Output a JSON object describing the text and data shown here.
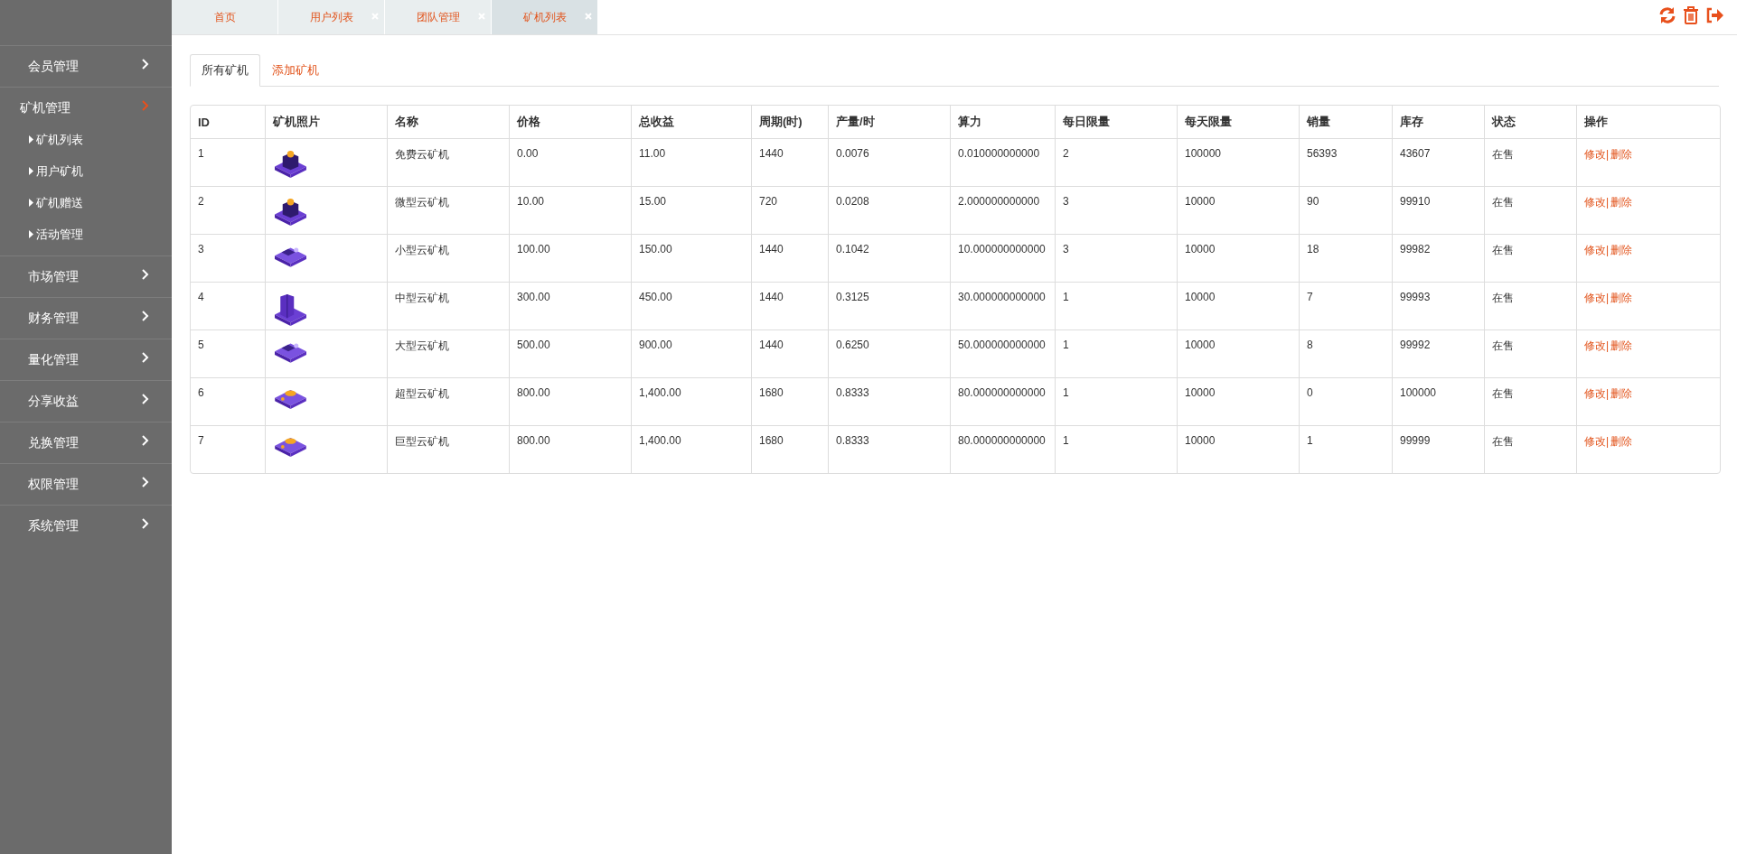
{
  "sidebar": {
    "items": [
      {
        "label": "会员管理",
        "expanded": false
      },
      {
        "label": "矿机管理",
        "expanded": true,
        "children": [
          {
            "label": "矿机列表"
          },
          {
            "label": "用户矿机"
          },
          {
            "label": "矿机赠送"
          },
          {
            "label": "活动管理"
          }
        ]
      },
      {
        "label": "市场管理",
        "expanded": false
      },
      {
        "label": "财务管理",
        "expanded": false
      },
      {
        "label": "量化管理",
        "expanded": false
      },
      {
        "label": "分享收益",
        "expanded": false
      },
      {
        "label": "兑换管理",
        "expanded": false
      },
      {
        "label": "权限管理",
        "expanded": false
      },
      {
        "label": "系统管理",
        "expanded": false
      }
    ]
  },
  "tabs": [
    {
      "label": "首页",
      "selected": false,
      "closable": false
    },
    {
      "label": "用户列表",
      "selected": false,
      "closable": true
    },
    {
      "label": "团队管理",
      "selected": false,
      "closable": true
    },
    {
      "label": "矿机列表",
      "selected": true,
      "closable": true
    }
  ],
  "toolbar": [
    {
      "kind": "refresh"
    },
    {
      "kind": "trash"
    },
    {
      "kind": "logout"
    }
  ],
  "sub_tabs": [
    {
      "label": "所有矿机",
      "selected": true
    },
    {
      "label": "添加矿机",
      "selected": false
    }
  ],
  "table": {
    "columns": [
      "ID",
      "矿机照片",
      "名称",
      "价格",
      "总收益",
      "周期(时)",
      "产量/时",
      "算力",
      "每日限量",
      "每天限量",
      "销量",
      "库存",
      "状态",
      "操作"
    ],
    "separator": "|",
    "rows": [
      {
        "id": "1",
        "kind": "tower",
        "name": "免费云矿机",
        "price": "0.00",
        "total": "11.00",
        "period": "1440",
        "output": "0.0076",
        "power": "0.010000000000",
        "daily_limit": "2",
        "day_limit": "100000",
        "sales": "56393",
        "stock": "43607",
        "status": "在售",
        "actions": [
          "修改",
          "删除"
        ]
      },
      {
        "id": "2",
        "kind": "tower",
        "name": "微型云矿机",
        "price": "10.00",
        "total": "15.00",
        "period": "720",
        "output": "0.0208",
        "power": "2.000000000000",
        "daily_limit": "3",
        "day_limit": "10000",
        "sales": "90",
        "stock": "99910",
        "status": "在售",
        "actions": [
          "修改",
          "删除"
        ]
      },
      {
        "id": "3",
        "kind": "flat",
        "name": "小型云矿机",
        "price": "100.00",
        "total": "150.00",
        "period": "1440",
        "output": "0.1042",
        "power": "10.000000000000",
        "daily_limit": "3",
        "day_limit": "10000",
        "sales": "18",
        "stock": "99982",
        "status": "在售",
        "actions": [
          "修改",
          "删除"
        ]
      },
      {
        "id": "4",
        "kind": "tall",
        "name": "中型云矿机",
        "price": "300.00",
        "total": "450.00",
        "period": "1440",
        "output": "0.3125",
        "power": "30.000000000000",
        "daily_limit": "1",
        "day_limit": "10000",
        "sales": "7",
        "stock": "99993",
        "status": "在售",
        "actions": [
          "修改",
          "删除"
        ]
      },
      {
        "id": "5",
        "kind": "flat",
        "name": "大型云矿机",
        "price": "500.00",
        "total": "900.00",
        "period": "1440",
        "output": "0.6250",
        "power": "50.000000000000",
        "daily_limit": "1",
        "day_limit": "10000",
        "sales": "8",
        "stock": "99992",
        "status": "在售",
        "actions": [
          "修改",
          "删除"
        ]
      },
      {
        "id": "6",
        "kind": "coin",
        "name": "超型云矿机",
        "price": "800.00",
        "total": "1,400.00",
        "period": "1680",
        "output": "0.8333",
        "power": "80.000000000000",
        "daily_limit": "1",
        "day_limit": "10000",
        "sales": "0",
        "stock": "100000",
        "status": "在售",
        "actions": [
          "修改",
          "删除"
        ]
      },
      {
        "id": "7",
        "kind": "coin",
        "name": "巨型云矿机",
        "price": "800.00",
        "total": "1,400.00",
        "period": "1680",
        "output": "0.8333",
        "power": "80.000000000000",
        "daily_limit": "1",
        "day_limit": "10000",
        "sales": "1",
        "stock": "99999",
        "status": "在售",
        "actions": [
          "修改",
          "删除"
        ]
      }
    ]
  }
}
